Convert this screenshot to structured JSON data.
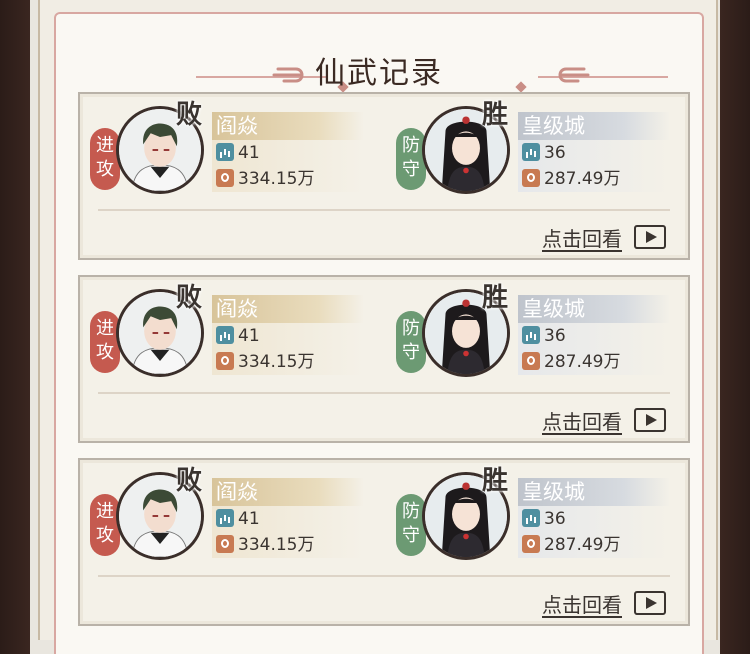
{
  "title": "仙武记录",
  "records": [
    {
      "attacker": {
        "side_label": "进攻",
        "result": "败",
        "name": "阎焱",
        "level": "41",
        "power": "334.15万"
      },
      "defender": {
        "side_label": "防守",
        "result": "胜",
        "name": "皇级城",
        "level": "36",
        "power": "287.49万"
      },
      "replay_label": "点击回看"
    },
    {
      "attacker": {
        "side_label": "进攻",
        "result": "败",
        "name": "阎焱",
        "level": "41",
        "power": "334.15万"
      },
      "defender": {
        "side_label": "防守",
        "result": "胜",
        "name": "皇级城",
        "level": "36",
        "power": "287.49万"
      },
      "replay_label": "点击回看"
    },
    {
      "attacker": {
        "side_label": "进攻",
        "result": "败",
        "name": "阎焱",
        "level": "41",
        "power": "334.15万"
      },
      "defender": {
        "side_label": "防守",
        "result": "胜",
        "name": "皇级城",
        "level": "36",
        "power": "287.49万"
      },
      "replay_label": "点击回看"
    }
  ],
  "colors": {
    "attack": "#c55a4f",
    "defend": "#6c9a73",
    "panel_border": "#d8a7a1"
  },
  "icons": {
    "level": "level-bars-icon",
    "power": "power-icon",
    "replay": "play-icon"
  }
}
